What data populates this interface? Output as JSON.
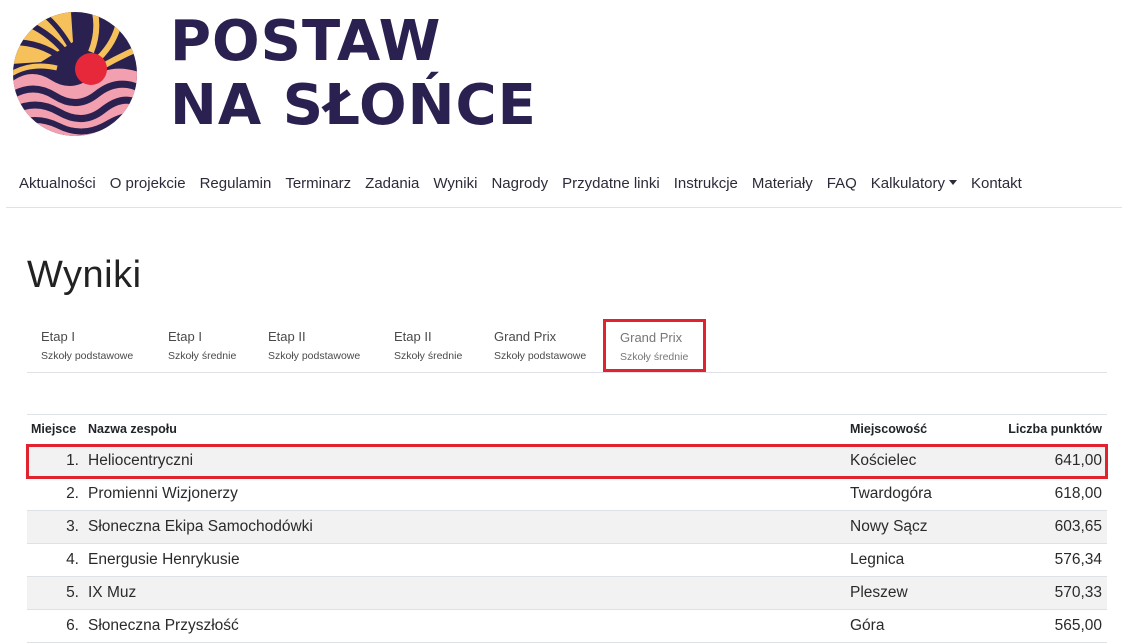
{
  "brand": {
    "line1": "POSTAW",
    "line2": "NA SŁOŃCE"
  },
  "nav": {
    "items": [
      {
        "label": "Aktualności"
      },
      {
        "label": "O projekcie"
      },
      {
        "label": "Regulamin"
      },
      {
        "label": "Terminarz"
      },
      {
        "label": "Zadania"
      },
      {
        "label": "Wyniki"
      },
      {
        "label": "Nagrody"
      },
      {
        "label": "Przydatne linki"
      },
      {
        "label": "Instrukcje"
      },
      {
        "label": "Materiały"
      },
      {
        "label": "FAQ"
      },
      {
        "label": "Kalkulatory",
        "dropdown": true
      },
      {
        "label": "Kontakt"
      }
    ]
  },
  "page": {
    "title": "Wyniki"
  },
  "tabs": [
    {
      "title": "Etap I",
      "subtitle": "Szkoły podstawowe"
    },
    {
      "title": "Etap I",
      "subtitle": "Szkoły średnie"
    },
    {
      "title": "Etap II",
      "subtitle": "Szkoły podstawowe"
    },
    {
      "title": "Etap II",
      "subtitle": "Szkoły średnie"
    },
    {
      "title": "Grand Prix",
      "subtitle": "Szkoły podstawowe"
    },
    {
      "title": "Grand Prix",
      "subtitle": "Szkoły średnie",
      "active": true
    }
  ],
  "table": {
    "headers": {
      "place": "Miejsce",
      "name": "Nazwa zespołu",
      "city": "Miejscowość",
      "points": "Liczba punktów"
    },
    "rows": [
      {
        "place": "1.",
        "name": "Heliocentryczni",
        "city": "Kościelec",
        "points": "641,00"
      },
      {
        "place": "2.",
        "name": "Promienni Wizjonerzy",
        "city": "Twardogóra",
        "points": "618,00"
      },
      {
        "place": "3.",
        "name": "Słoneczna Ekipa Samochodówki",
        "city": "Nowy Sącz",
        "points": "603,65"
      },
      {
        "place": "4.",
        "name": "Energusie Henrykusie",
        "city": "Legnica",
        "points": "576,34"
      },
      {
        "place": "5.",
        "name": "IX Muz",
        "city": "Pleszew",
        "points": "570,33"
      },
      {
        "place": "6.",
        "name": "Słoneczna Przyszłość",
        "city": "Góra",
        "points": "565,00"
      }
    ]
  },
  "colors": {
    "brand": "#2b2150",
    "accent_red": "#e0232f",
    "logo_yellow": "#f6c15b",
    "logo_pink": "#f2a0b0",
    "logo_navy": "#2b2150"
  }
}
